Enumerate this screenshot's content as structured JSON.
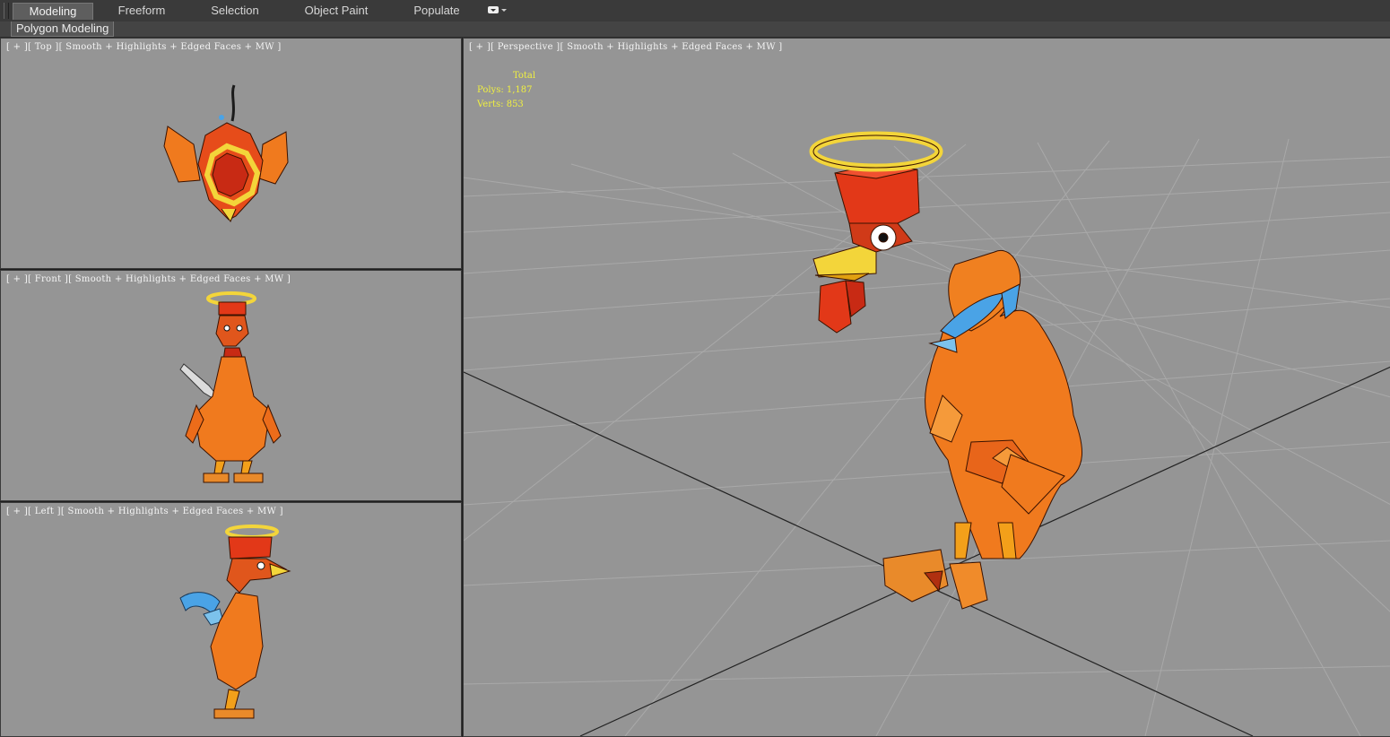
{
  "ribbon": {
    "tabs": [
      "Modeling",
      "Freeform",
      "Selection",
      "Object Paint",
      "Populate"
    ],
    "active_tab": "Modeling",
    "sub_tab": "Polygon Modeling"
  },
  "viewports": {
    "top": {
      "label": "[ + ][ Top ][ Smooth + Highlights + Edged Faces + MW ]"
    },
    "front": {
      "label": "[ + ][ Front ][ Smooth + Highlights + Edged Faces + MW ]"
    },
    "left": {
      "label": "[ + ][ Left ][ Smooth + Highlights + Edged Faces + MW ]"
    },
    "perspective": {
      "label": "[ + ][ Perspective ][ Smooth + Highlights + Edged Faces + MW ]",
      "stats": {
        "header": "Total",
        "polys": "Polys: 1,187",
        "verts": "Verts: 853"
      }
    }
  },
  "colors": {
    "viewport_bg": "#959595",
    "grid": "#a8a8a8",
    "axis": "#222222",
    "body": "#f07a1e",
    "comb": "#e23818",
    "halo": "#f3d53a",
    "tail": "#4aa3e6",
    "stats_text": "#f0f040"
  }
}
